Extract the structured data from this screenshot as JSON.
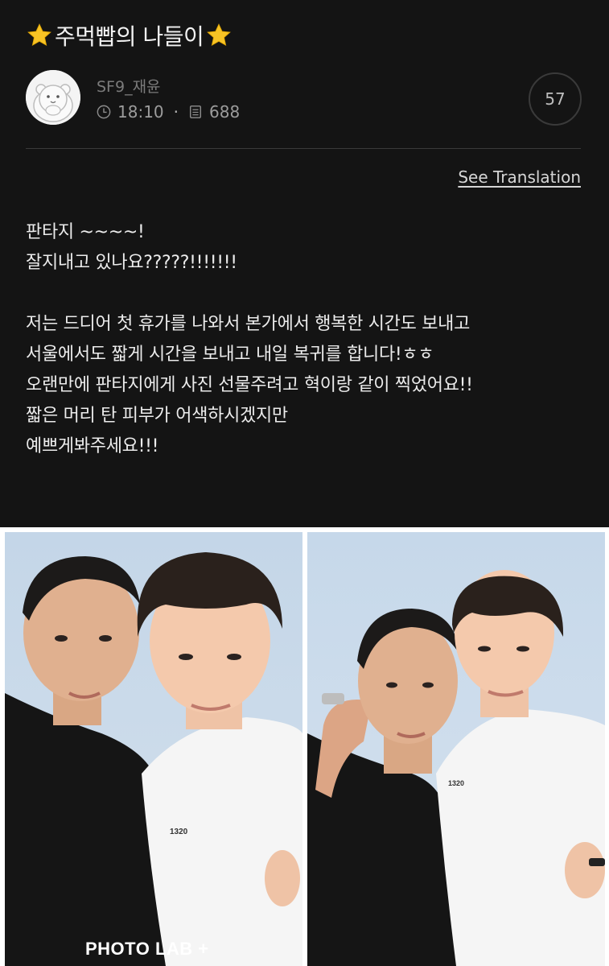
{
  "post": {
    "title": "⭐주먹빱의 나들이⭐",
    "title_text": "주먹빱의 나들이",
    "author": "SF9_재윤",
    "time": "18:10",
    "separator": "·",
    "views": "688",
    "comment_count": "57",
    "see_translation": "See Translation",
    "body_lines": [
      "판타지 ~~~~!",
      "잘지내고 있나요?????!!!!!!!",
      "",
      "저는 드디어 첫 휴가를 나와서 본가에서 행복한 시간도 보내고",
      "서울에서도 짧게 시간을 보내고 내일 복귀를 합니다!ㅎㅎ",
      "오랜만에 판타지에게 사진 선물주려고 혁이랑 같이 찍었어요!!",
      "짧은 머리 탄 피부가 어색하시겠지만",
      "예쁘게봐주세요!!!"
    ]
  },
  "photos": {
    "watermark": "PHOTO LAB +",
    "shirt_print": "1320"
  },
  "icons": {
    "title_star": "star-icon",
    "avatar": "hamster-avatar",
    "time": "clock-icon",
    "views": "document-icon"
  },
  "colors": {
    "background": "#141414",
    "text": "#ececec",
    "muted": "#9c9c9c",
    "star": "#f5c518",
    "photo_bg": "#c9d9e9"
  }
}
